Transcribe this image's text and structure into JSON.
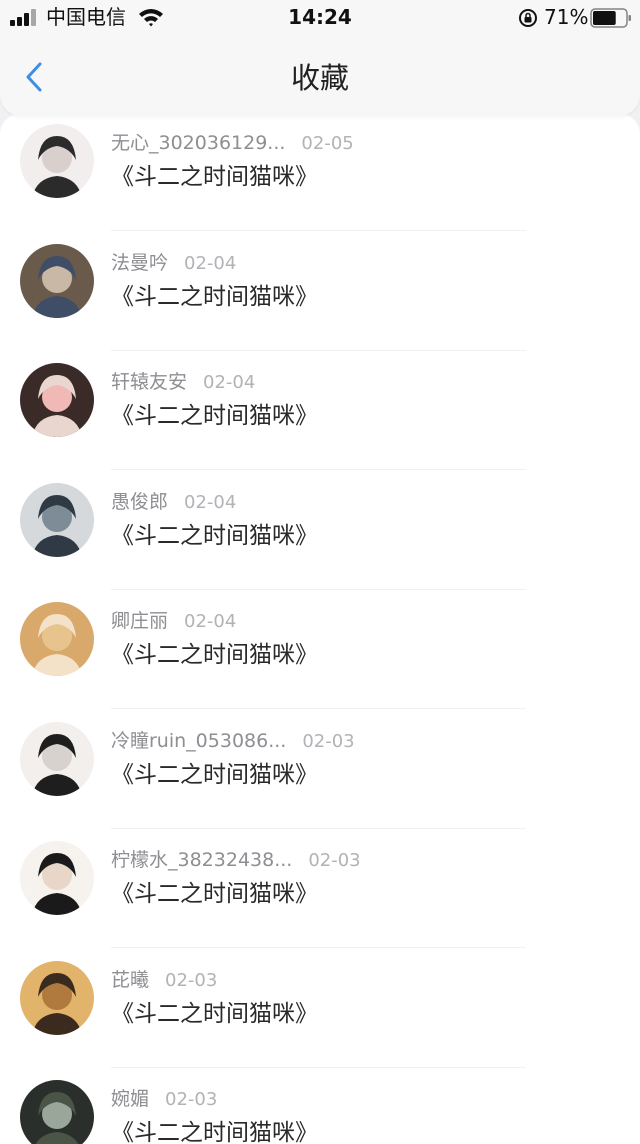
{
  "status_bar": {
    "carrier": "中国电信",
    "time": "14:24",
    "battery_percent": "71%",
    "battery_level": 0.71,
    "signal_icon": "signal-icon",
    "wifi_icon": "wifi-icon",
    "lock_icon": "orientation-lock-icon",
    "battery_icon": "battery-icon"
  },
  "nav": {
    "title": "收藏",
    "back_icon": "chevron-left-icon",
    "accent_color": "#3a8ee6"
  },
  "favorites": [
    {
      "user": "无心_302036129...",
      "date": "02-05",
      "title": "《斗二之时间猫咪》",
      "avatar_colors": [
        "#2b2b2b",
        "#d9cfcc",
        "#f3eeee"
      ]
    },
    {
      "user": "法曼吟",
      "date": "02-04",
      "title": "《斗二之时间猫咪》",
      "avatar_colors": [
        "#3f4e66",
        "#c9b8a6",
        "#6a5a4c"
      ]
    },
    {
      "user": "轩辕友安",
      "date": "02-04",
      "title": "《斗二之时间猫咪》",
      "avatar_colors": [
        "#e9d6cf",
        "#f0b9b5",
        "#3a2a28"
      ]
    },
    {
      "user": "愚俊郎",
      "date": "02-04",
      "title": "《斗二之时间猫咪》",
      "avatar_colors": [
        "#2f3a44",
        "#7d8c96",
        "#d5d9dc"
      ]
    },
    {
      "user": "卿庄丽",
      "date": "02-04",
      "title": "《斗二之时间猫咪》",
      "avatar_colors": [
        "#f3e1c8",
        "#e7c48e",
        "#d9a96c"
      ]
    },
    {
      "user": "冷瞳ruin_053086...",
      "date": "02-03",
      "title": "《斗二之时间猫咪》",
      "avatar_colors": [
        "#1e1e1e",
        "#d8d2ce",
        "#f2efed"
      ]
    },
    {
      "user": "柠檬水_38232438...",
      "date": "02-03",
      "title": "《斗二之时间猫咪》",
      "avatar_colors": [
        "#1a1a1a",
        "#e8d6c8",
        "#f6f2ee"
      ]
    },
    {
      "user": "芘曦",
      "date": "02-03",
      "title": "《斗二之时间猫咪》",
      "avatar_colors": [
        "#3b2a1e",
        "#b07a3e",
        "#e2b36a"
      ]
    },
    {
      "user": "婉媚",
      "date": "02-03",
      "title": "《斗二之时间猫咪》",
      "avatar_colors": [
        "#4a5548",
        "#9aa69a",
        "#2b2f2b"
      ]
    }
  ]
}
